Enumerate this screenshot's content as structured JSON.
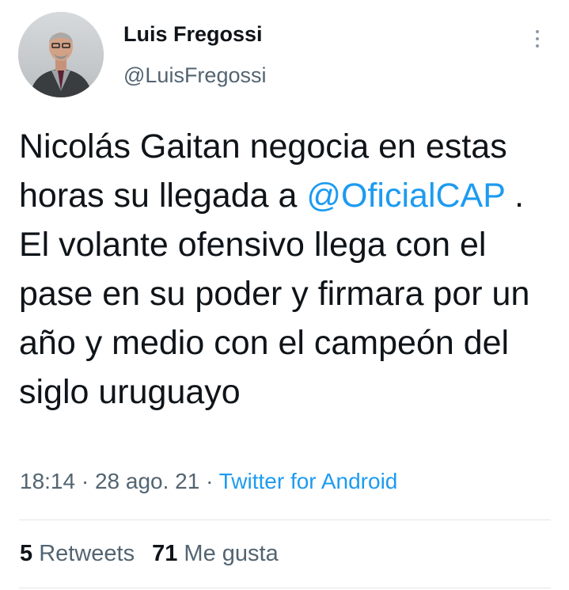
{
  "author": {
    "name": "Luis Fregossi",
    "handle": "@LuisFregossi",
    "avatar_icon": "profile-photo"
  },
  "tweet": {
    "text_before": "Nicolás Gaitan negocia en estas horas su llegada a",
    "mention": "@OficialCAP",
    "text_after": ". El volante ofensivo llega con el pase en su poder y firmara por un año y medio con el campeón del siglo uruguayo"
  },
  "meta": {
    "time": "18:14",
    "separator": "·",
    "date": "28 ago. 21",
    "source": "Twitter for Android"
  },
  "stats": {
    "retweets_count": "5",
    "retweets_label": "Retweets",
    "likes_count": "71",
    "likes_label": "Me gusta"
  },
  "colors": {
    "link": "#1d9bf0",
    "secondary": "#536471",
    "text": "#0f1419"
  }
}
